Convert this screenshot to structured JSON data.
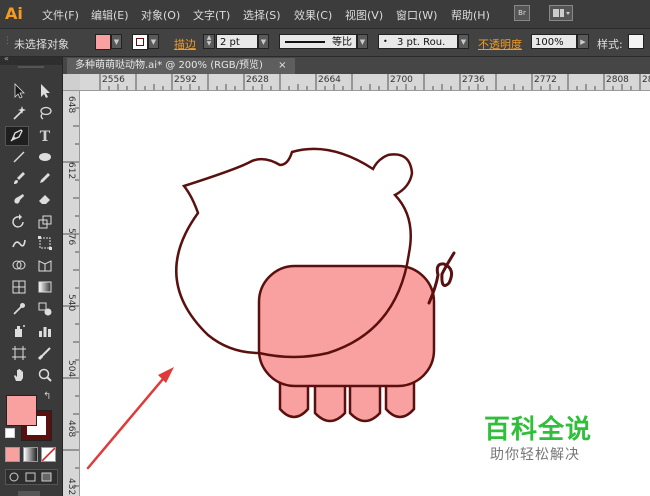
{
  "app": {
    "logo": "Ai"
  },
  "menu": {
    "items": [
      "文件(F)",
      "编辑(E)",
      "对象(O)",
      "文字(T)",
      "选择(S)",
      "效果(C)",
      "视图(V)",
      "窗口(W)",
      "帮助(H)"
    ],
    "bridge_label": "Br"
  },
  "control": {
    "selection": "未选择对象",
    "stroke_label": "描边",
    "stroke_weight": "2 pt",
    "profile": "等比",
    "brush": "3 pt. Rou.",
    "opacity_label": "不透明度",
    "opacity_value": "100%",
    "style_label": "样式:",
    "fill_color": "#f9a1a1",
    "stroke_color": "#5b1010"
  },
  "document": {
    "tab_title": "多种萌萌哒动物.ai* @ 200% (RGB/预览)",
    "close_glyph": "×"
  },
  "rulers": {
    "horizontal": [
      "2556",
      "2592",
      "2628",
      "2664",
      "2700",
      "2736",
      "2772",
      "2808",
      "2844"
    ],
    "vertical": [
      "648",
      "612",
      "576",
      "540",
      "504",
      "468",
      "432"
    ]
  },
  "watermark": {
    "title": "百科全说",
    "subtitle": "助你轻松解决"
  }
}
